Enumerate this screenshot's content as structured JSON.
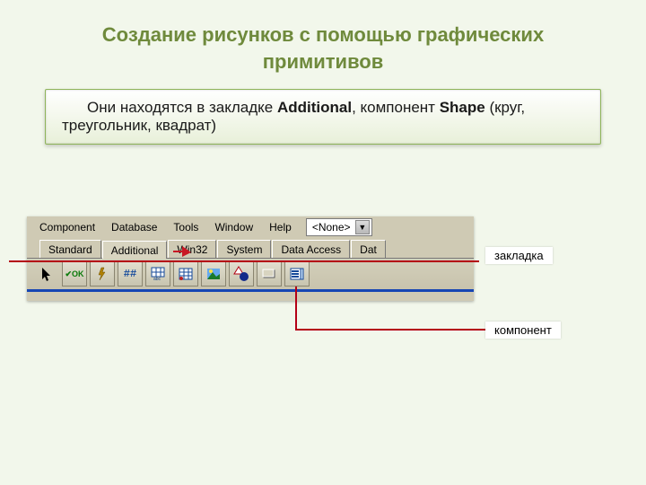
{
  "title": "Создание рисунков с помощью графических примитивов",
  "info_prefix": "Они находятся в закладке ",
  "info_bold1": "Additional",
  "info_mid": ", компонент ",
  "info_bold2": "Shape",
  "info_suffix": " (круг, треугольник, квадрат)",
  "menu": {
    "component": "Component",
    "database": "Database",
    "tools": "Tools",
    "window": "Window",
    "help": "Help",
    "combo_value": "<None>"
  },
  "tabs": {
    "standard": "Standard",
    "additional": "Additional",
    "win32": "Win32",
    "system": "System",
    "data_access": "Data Access",
    "dat": "Dat"
  },
  "palette": {
    "ok": "✔OK",
    "hash": "##"
  },
  "annotations": {
    "tab": "закладка",
    "component": "компонент"
  }
}
